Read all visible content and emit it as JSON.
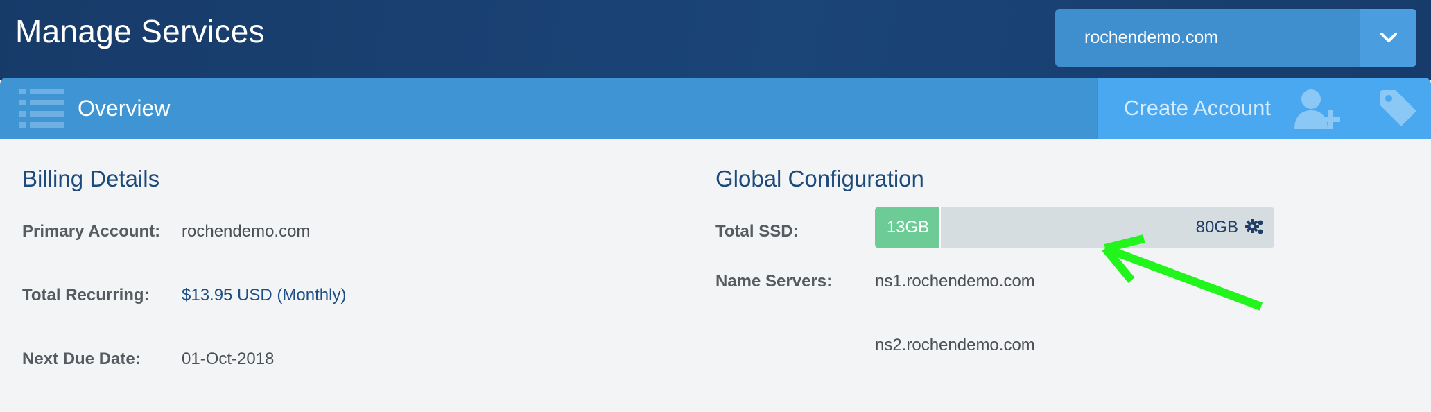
{
  "header": {
    "title": "Manage Services",
    "domain_select": {
      "value": "rochendemo.com",
      "chevron_icon": "chevron-down-icon"
    }
  },
  "tabbar": {
    "overview_icon": "list-icon",
    "overview_label": "Overview",
    "create_account_label": "Create Account",
    "create_account_icon": "user-plus-icon",
    "tag_icon": "tag-icon"
  },
  "billing": {
    "title": "Billing Details",
    "rows": [
      {
        "label": "Primary Account:",
        "value": "rochendemo.com"
      },
      {
        "label": "Total Recurring:",
        "value": "$13.95 USD (Monthly)"
      },
      {
        "label": "Next Due Date:",
        "value": "01-Oct-2018"
      }
    ]
  },
  "global_config": {
    "title": "Global Configuration",
    "ssd": {
      "label": "Total SSD:",
      "used_label": "13GB",
      "total_label": "80GB",
      "used_fraction": 0.165,
      "settings_icon": "gears-icon"
    },
    "name_servers": {
      "label": "Name Servers:",
      "values": [
        "ns1.rochendemo.com",
        "ns2.rochendemo.com"
      ]
    }
  },
  "annotation": {
    "arrow_color": "#22f51c"
  },
  "colors": {
    "header_bg": "#173b69",
    "tabbar_bg": "#3f94d3",
    "accent_button": "#4aa8f1",
    "ssd_used": "#6dcc96"
  }
}
